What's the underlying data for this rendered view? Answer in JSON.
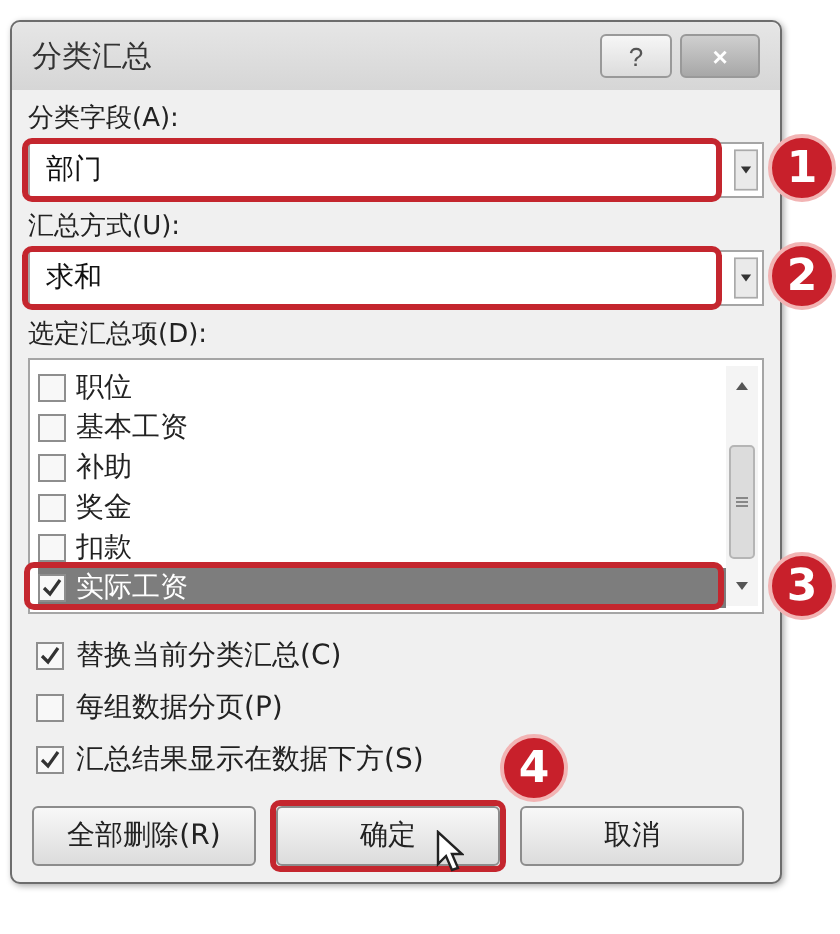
{
  "window": {
    "title": "分类汇总",
    "help_button": "?",
    "close_button": "×"
  },
  "group_by": {
    "label": "分类字段(A):",
    "value": "部门",
    "annotation": "1"
  },
  "summary_function": {
    "label": "汇总方式(U):",
    "value": "求和",
    "annotation": "2"
  },
  "summary_items": {
    "label": "选定汇总项(D):",
    "annotation": "3",
    "items": [
      {
        "label": "职位",
        "checked": false,
        "selected": false
      },
      {
        "label": "基本工资",
        "checked": false,
        "selected": false
      },
      {
        "label": "补助",
        "checked": false,
        "selected": false
      },
      {
        "label": "奖金",
        "checked": false,
        "selected": false
      },
      {
        "label": "扣款",
        "checked": false,
        "selected": false
      },
      {
        "label": "实际工资",
        "checked": true,
        "selected": true
      }
    ]
  },
  "options": [
    {
      "label": "替换当前分类汇总(C)",
      "checked": true
    },
    {
      "label": "每组数据分页(P)",
      "checked": false
    },
    {
      "label": "汇总结果显示在数据下方(S)",
      "checked": true
    }
  ],
  "buttons": [
    {
      "label": "全部删除(R)"
    },
    {
      "label": "确定",
      "annotation": "4"
    },
    {
      "label": "取消"
    }
  ]
}
